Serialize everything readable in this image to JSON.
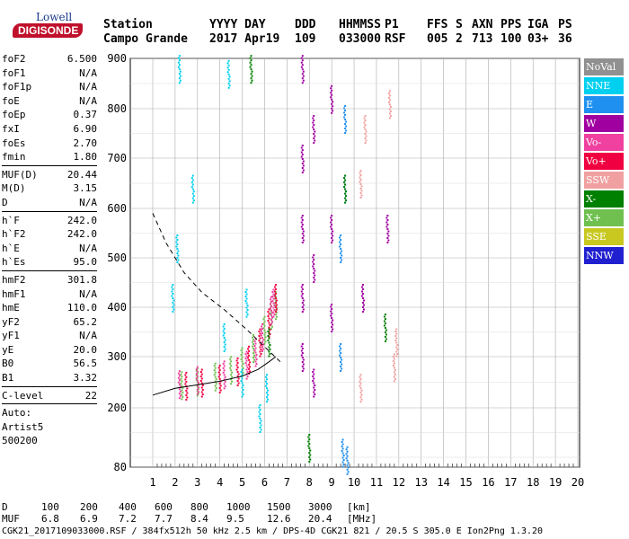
{
  "logo": {
    "line1": "Lowell",
    "line2": "DIGISONDE"
  },
  "header": {
    "row1": [
      "Station",
      "YYYY DAY",
      "DDD",
      "HHMMSS",
      "P1",
      "FFS",
      "S",
      "AXN",
      "PPS",
      "IGA",
      "PS"
    ],
    "row2": [
      "Campo Grande",
      "2017 Apr19",
      "109",
      "033000",
      "RSF",
      "005",
      "2",
      "713",
      "100",
      "03+",
      "36"
    ]
  },
  "params": [
    [
      [
        "foF2",
        "6.500"
      ],
      [
        "foF1",
        "N/A"
      ],
      [
        "foF1p",
        "N/A"
      ],
      [
        "foE",
        "N/A"
      ],
      [
        "foEp",
        "0.37"
      ],
      [
        "fxI",
        "6.90"
      ],
      [
        "foEs",
        "2.70"
      ],
      [
        "fmin",
        "1.80"
      ]
    ],
    [
      [
        "MUF(D)",
        "20.44"
      ],
      [
        "M(D)",
        "3.15"
      ],
      [
        "D",
        "N/A"
      ]
    ],
    [
      [
        "h`F",
        "242.0"
      ],
      [
        "h`F2",
        "242.0"
      ],
      [
        "h`E",
        "N/A"
      ],
      [
        "h`Es",
        "95.0"
      ]
    ],
    [
      [
        "hmF2",
        "301.8"
      ],
      [
        "hmF1",
        "N/A"
      ],
      [
        "hmE",
        "110.0"
      ],
      [
        "yF2",
        "65.2"
      ],
      [
        "yF1",
        "N/A"
      ],
      [
        "yE",
        "20.0"
      ],
      [
        "B0",
        "56.5"
      ],
      [
        "B1",
        "3.32"
      ]
    ],
    [
      [
        "C-level",
        "22"
      ]
    ],
    [
      [
        "Auto:",
        ""
      ],
      [
        "Artist5",
        ""
      ],
      [
        "500200",
        ""
      ]
    ]
  ],
  "legend": [
    {
      "label": "NoVal",
      "color": "#909090"
    },
    {
      "label": "NNE",
      "color": "#00d0f0"
    },
    {
      "label": "E",
      "color": "#2090f0"
    },
    {
      "label": "W",
      "color": "#a000a0"
    },
    {
      "label": "Vo-",
      "color": "#f040a0"
    },
    {
      "label": "Vo+",
      "color": "#f00040"
    },
    {
      "label": "SSW",
      "color": "#f0a0a0"
    },
    {
      "label": "X-",
      "color": "#008000"
    },
    {
      "label": "X+",
      "color": "#70c050"
    },
    {
      "label": "SSE",
      "color": "#c8c820"
    },
    {
      "label": "NNW",
      "color": "#2020d0"
    }
  ],
  "bottom": {
    "d_label": "D",
    "d_values": [
      "100",
      "200",
      "400",
      "600",
      "800",
      "1000",
      "1500",
      "3000",
      "[km]"
    ],
    "muf_label": "MUF",
    "muf_values": [
      "6.8",
      "6.9",
      "7.2",
      "7.7",
      "8.4",
      "9.5",
      "12.6",
      "20.4",
      "[MHz]"
    ],
    "footer": "CGK21_2017109033000.RSF / 384fx512h 50 kHz 2.5 km / DPS-4D CGK21 821 / 20.5 S 305.0 E Ion2Png 1.3.20"
  },
  "chart_data": {
    "type": "scatter",
    "x_ticks": [
      1,
      2,
      3,
      4,
      5,
      6,
      7,
      8,
      9,
      10,
      11,
      12,
      13,
      14,
      15,
      16,
      17,
      18,
      19,
      20
    ],
    "y_ticks": [
      80,
      200,
      300,
      400,
      500,
      600,
      700,
      800,
      900
    ],
    "xlim": [
      1,
      20
    ],
    "ylim": [
      80,
      900
    ],
    "grid": true,
    "series": [
      {
        "name": "X+",
        "color": "#70c050",
        "points": [
          [
            2.3,
            245
          ],
          [
            3.0,
            252
          ],
          [
            3.8,
            262
          ],
          [
            4.5,
            275
          ],
          [
            5.0,
            292
          ],
          [
            5.5,
            318
          ],
          [
            6.0,
            355
          ],
          [
            6.3,
            385
          ],
          [
            6.5,
            405
          ]
        ]
      },
      {
        "name": "Vo+",
        "color": "#f00040",
        "points": [
          [
            2.5,
            244
          ],
          [
            3.2,
            250
          ],
          [
            4.0,
            258
          ],
          [
            4.8,
            272
          ],
          [
            5.3,
            295
          ],
          [
            5.8,
            330
          ],
          [
            6.2,
            370
          ],
          [
            6.5,
            420
          ]
        ]
      },
      {
        "name": "Vo-",
        "color": "#f040a0",
        "points": [
          [
            2.2,
            247
          ],
          [
            3.0,
            255
          ],
          [
            4.2,
            266
          ],
          [
            5.2,
            285
          ],
          [
            5.6,
            310
          ],
          [
            5.9,
            340
          ],
          [
            6.3,
            395
          ],
          [
            6.4,
            410
          ]
        ]
      },
      {
        "name": "W",
        "color": "#a000a0",
        "points": [
          [
            7.7,
            300
          ],
          [
            7.7,
            420
          ],
          [
            7.7,
            560
          ],
          [
            7.7,
            700
          ],
          [
            7.7,
            880
          ],
          [
            8.2,
            250
          ],
          [
            8.2,
            480
          ],
          [
            8.2,
            760
          ],
          [
            9.0,
            380
          ],
          [
            9.0,
            560
          ],
          [
            9.0,
            820
          ],
          [
            10.4,
            420
          ],
          [
            11.5,
            560
          ]
        ]
      },
      {
        "name": "E",
        "color": "#2090f0",
        "points": [
          [
            9.4,
            300
          ],
          [
            9.4,
            520
          ],
          [
            9.6,
            640
          ],
          [
            9.6,
            780
          ],
          [
            9.5,
            110
          ],
          [
            9.7,
            95
          ]
        ]
      },
      {
        "name": "NNE",
        "color": "#00d0f0",
        "points": [
          [
            1.9,
            420
          ],
          [
            2.1,
            520
          ],
          [
            2.2,
            880
          ],
          [
            2.8,
            640
          ],
          [
            4.2,
            340
          ],
          [
            4.4,
            870
          ],
          [
            5.0,
            250
          ],
          [
            5.2,
            410
          ],
          [
            5.8,
            180
          ],
          [
            6.1,
            240
          ]
        ]
      },
      {
        "name": "SSW",
        "color": "#f0a0a0",
        "points": [
          [
            10.3,
            650
          ],
          [
            10.5,
            760
          ],
          [
            10.3,
            240
          ],
          [
            11.6,
            810
          ],
          [
            11.8,
            280
          ],
          [
            11.9,
            330
          ]
        ]
      },
      {
        "name": "X-",
        "color": "#008000",
        "points": [
          [
            5.4,
            880
          ],
          [
            6.2,
            330
          ],
          [
            9.6,
            640
          ],
          [
            11.4,
            360
          ],
          [
            8.0,
            120
          ]
        ]
      }
    ],
    "curves": [
      {
        "style": "dashed",
        "points": [
          [
            1.0,
            590
          ],
          [
            1.6,
            530
          ],
          [
            2.4,
            470
          ],
          [
            3.2,
            430
          ],
          [
            4.2,
            395
          ],
          [
            5.2,
            355
          ],
          [
            6.0,
            320
          ],
          [
            6.7,
            290
          ]
        ]
      },
      {
        "style": "solid",
        "points": [
          [
            1.0,
            225
          ],
          [
            2.0,
            238
          ],
          [
            3.0,
            245
          ],
          [
            4.0,
            252
          ],
          [
            5.0,
            262
          ],
          [
            5.7,
            275
          ],
          [
            6.2,
            290
          ],
          [
            6.5,
            300
          ]
        ]
      }
    ]
  }
}
